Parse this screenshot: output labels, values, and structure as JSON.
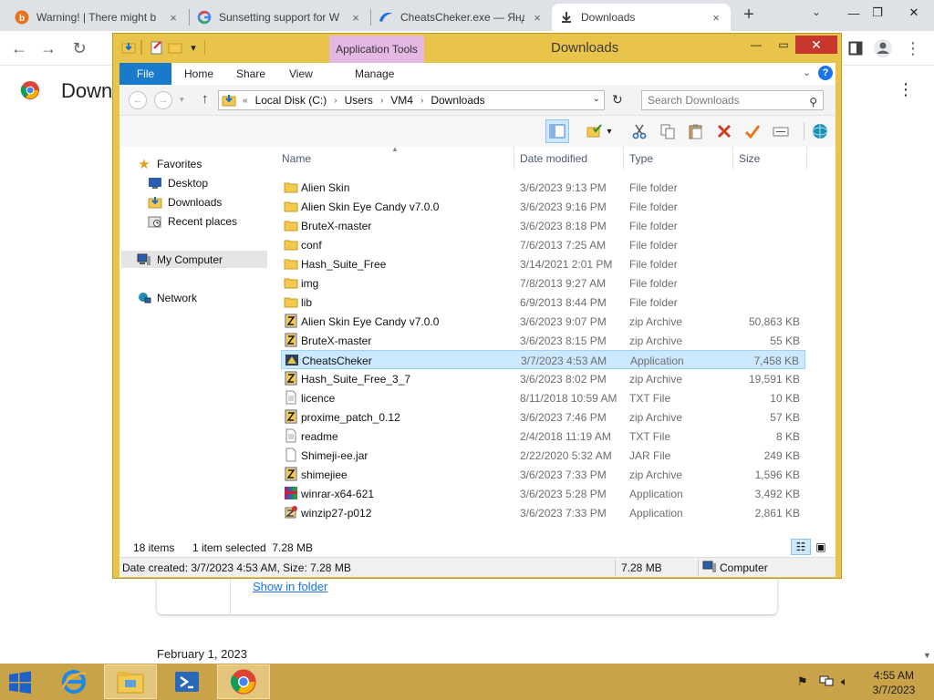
{
  "chrome": {
    "tabs": [
      {
        "label": "Warning! | There might b",
        "favicon": "warning-favicon"
      },
      {
        "label": "Sunsetting support for W",
        "favicon": "google-favicon"
      },
      {
        "label": "CheatsCheker.exe — Янд",
        "favicon": "yandex-disk-favicon"
      },
      {
        "label": "Downloads",
        "favicon": "download-favicon",
        "active": true
      }
    ],
    "tab_close": "×",
    "new_tab": "+",
    "page_title": "Down",
    "show_in_folder": "Show in folder",
    "date_header": "February 1, 2023"
  },
  "explorer": {
    "title": "Downloads",
    "app_tools": "Application Tools",
    "ribbon_tabs": [
      "File",
      "Home",
      "Share",
      "View",
      "Manage"
    ],
    "breadcrumb": [
      "Local Disk (C:)",
      "Users",
      "VM4",
      "Downloads"
    ],
    "breadcrumb_prefix": "«",
    "search_placeholder": "Search Downloads",
    "nav": {
      "favorites": "Favorites",
      "desktop": "Desktop",
      "downloads": "Downloads",
      "recent": "Recent places",
      "my_computer": "My Computer",
      "network": "Network"
    },
    "columns": {
      "name": "Name",
      "date": "Date modified",
      "type": "Type",
      "size": "Size"
    },
    "files": [
      {
        "name": "Alien Skin",
        "date": "3/6/2023 9:13 PM",
        "type": "File folder",
        "size": "",
        "icon": "folder-icon"
      },
      {
        "name": "Alien Skin Eye Candy v7.0.0",
        "date": "3/6/2023 9:16 PM",
        "type": "File folder",
        "size": "",
        "icon": "folder-icon"
      },
      {
        "name": "BruteX-master",
        "date": "3/6/2023 8:18 PM",
        "type": "File folder",
        "size": "",
        "icon": "folder-icon"
      },
      {
        "name": "conf",
        "date": "7/6/2013 7:25 AM",
        "type": "File folder",
        "size": "",
        "icon": "folder-icon"
      },
      {
        "name": "Hash_Suite_Free",
        "date": "3/14/2021 2:01 PM",
        "type": "File folder",
        "size": "",
        "icon": "folder-icon"
      },
      {
        "name": "img",
        "date": "7/8/2013 9:27 AM",
        "type": "File folder",
        "size": "",
        "icon": "folder-icon"
      },
      {
        "name": "lib",
        "date": "6/9/2013 8:44 PM",
        "type": "File folder",
        "size": "",
        "icon": "folder-icon"
      },
      {
        "name": "Alien Skin Eye Candy v7.0.0",
        "date": "3/6/2023 9:07 PM",
        "type": "zip Archive",
        "size": "50,863 KB",
        "icon": "zip-icon"
      },
      {
        "name": "BruteX-master",
        "date": "3/6/2023 8:15 PM",
        "type": "zip Archive",
        "size": "55 KB",
        "icon": "zip-icon"
      },
      {
        "name": "CheatsCheker",
        "date": "3/7/2023 4:53 AM",
        "type": "Application",
        "size": "7,458 KB",
        "icon": "app-icon",
        "selected": true
      },
      {
        "name": "Hash_Suite_Free_3_7",
        "date": "3/6/2023 8:02 PM",
        "type": "zip Archive",
        "size": "19,591 KB",
        "icon": "zip-icon"
      },
      {
        "name": "licence",
        "date": "8/11/2018 10:59 AM",
        "type": "TXT File",
        "size": "10 KB",
        "icon": "text-file-icon"
      },
      {
        "name": "proxime_patch_0.12",
        "date": "3/6/2023 7:46 PM",
        "type": "zip Archive",
        "size": "57 KB",
        "icon": "zip-icon"
      },
      {
        "name": "readme",
        "date": "2/4/2018 11:19 AM",
        "type": "TXT File",
        "size": "8 KB",
        "icon": "text-file-icon"
      },
      {
        "name": "Shimeji-ee.jar",
        "date": "2/22/2020 5:32 AM",
        "type": "JAR File",
        "size": "249 KB",
        "icon": "jar-file-icon"
      },
      {
        "name": "shimejiee",
        "date": "3/6/2023 7:33 PM",
        "type": "zip Archive",
        "size": "1,596 KB",
        "icon": "zip-icon"
      },
      {
        "name": "winrar-x64-621",
        "date": "3/6/2023 5:28 PM",
        "type": "Application",
        "size": "3,492 KB",
        "icon": "winrar-icon"
      },
      {
        "name": "winzip27-p012",
        "date": "3/6/2023 7:33 PM",
        "type": "Application",
        "size": "2,861 KB",
        "icon": "winzip-icon"
      }
    ],
    "status": {
      "items": "18 items",
      "selected": "1 item selected  7.28 MB"
    },
    "details": {
      "info": "Date created: 3/7/2023 4:53 AM, Size: 7.28 MB",
      "size": "7.28 MB",
      "location": "Computer"
    }
  },
  "taskbar": {
    "time": "4:55 AM",
    "date": "3/7/2023"
  },
  "colors": {
    "explorer_frame": "#e8c54a",
    "taskbar": "#c8a34a",
    "app_tools": "#e5b7e3",
    "file_tab": "#1979ca",
    "selection": "#cce8ff",
    "close_button": "#c8372d"
  }
}
